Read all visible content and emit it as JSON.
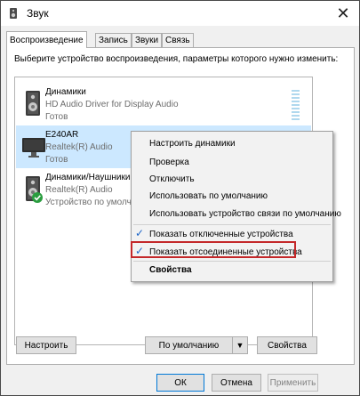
{
  "window": {
    "title": "Звук"
  },
  "tabs": [
    {
      "label": "Воспроизведение"
    },
    {
      "label": "Запись"
    },
    {
      "label": "Звуки"
    },
    {
      "label": "Связь"
    }
  ],
  "prompt": "Выберите устройство воспроизведения, параметры которого нужно изменить:",
  "devices": [
    {
      "name": "Динамики",
      "driver": "HD Audio Driver for Display Audio",
      "status": "Готов",
      "icon": "speaker-icon"
    },
    {
      "name": "E240AR",
      "driver": "Realtek(R) Audio",
      "status": "Готов",
      "icon": "monitor-icon"
    },
    {
      "name": "Динамики/Наушники",
      "driver": "Realtek(R) Audio",
      "status": "Устройство по умолчанию",
      "icon": "speaker-default-icon"
    }
  ],
  "context_menu": {
    "items": [
      {
        "label": "Настроить динамики"
      },
      {
        "label": "Проверка"
      },
      {
        "label": "Отключить"
      },
      {
        "label": "Использовать по умолчанию"
      },
      {
        "label": "Использовать устройство связи по умолчанию"
      }
    ],
    "checked_items": [
      {
        "label": "Показать отключенные устройства",
        "checked": true
      },
      {
        "label": "Показать отсоединенные устройства",
        "checked": true
      }
    ],
    "properties": {
      "label": "Свойства"
    }
  },
  "panel_buttons": {
    "configure": "Настроить",
    "default": "По умолчанию",
    "properties": "Свойства"
  },
  "dialog_buttons": {
    "ok": "ОК",
    "cancel": "Отмена",
    "apply": "Применить"
  },
  "colors": {
    "selection": "#cce8ff",
    "highlight_border": "#c4282a",
    "accent": "#0078d7"
  }
}
